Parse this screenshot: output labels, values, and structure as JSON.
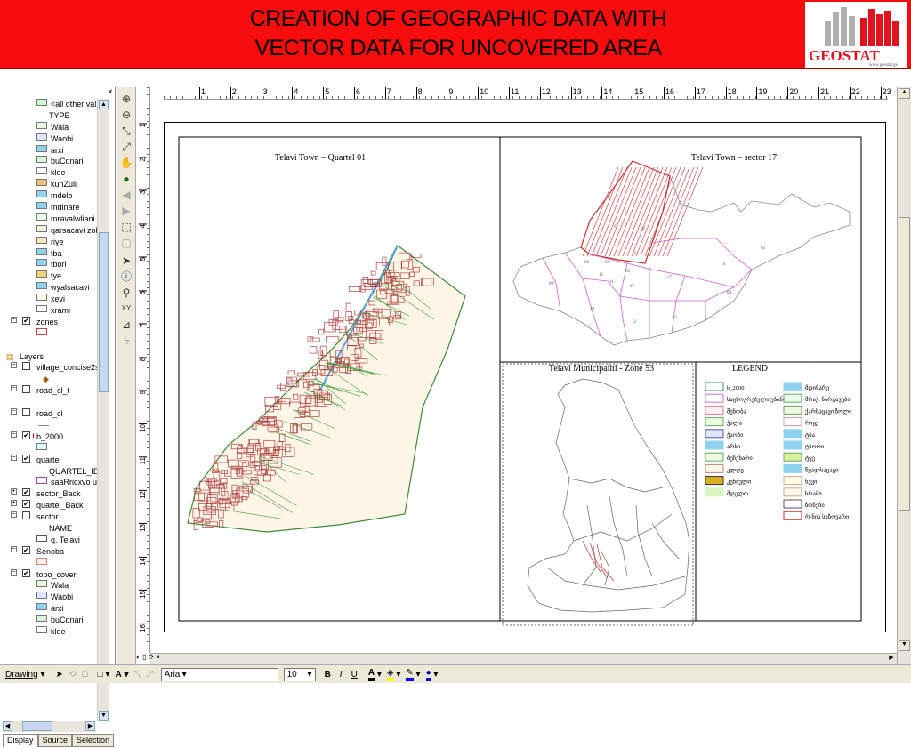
{
  "banner": {
    "title_line1": "CREATION OF GEOGRAPHIC DATA WITH",
    "title_line2": "VECTOR DATA FOR UNCOVERED AREA",
    "logo_text": "GEOSTAT",
    "logo_sub": "www.geostat.ge",
    "bg_color": "#f70d0d"
  },
  "toc": {
    "close": "×",
    "rows": [
      {
        "type": "item",
        "indent": 38,
        "swatch": "#ccffcc",
        "label": "<all other val"
      },
      {
        "type": "text",
        "indent": 52,
        "label": "TYPE"
      },
      {
        "type": "item",
        "indent": 38,
        "swatch": "#e8ffe0",
        "label": "Wala"
      },
      {
        "type": "item",
        "indent": 38,
        "swatch": "#dfe6ff",
        "label": "Waobi"
      },
      {
        "type": "item",
        "indent": 38,
        "swatch": "#8fd3f0",
        "label": "arxi"
      },
      {
        "type": "item",
        "indent": 38,
        "swatch": "#d9f5d9",
        "label": "buCqnari"
      },
      {
        "type": "item",
        "indent": 38,
        "swatch": "#ffffff",
        "label": "klde"
      },
      {
        "type": "item",
        "indent": 38,
        "swatch": "#f2c27a",
        "label": "kunZuli"
      },
      {
        "type": "item",
        "indent": 38,
        "swatch": "#8fd3f0",
        "label": "mdelo"
      },
      {
        "type": "item",
        "indent": 38,
        "swatch": "#8fd3f0",
        "label": "mdinare"
      },
      {
        "type": "item",
        "indent": 38,
        "swatch": "#eaffea",
        "label": "mravalwliani r"
      },
      {
        "type": "item",
        "indent": 38,
        "swatch": "#eefae0",
        "label": "qarsacavi zoli"
      },
      {
        "type": "item",
        "indent": 38,
        "swatch": "#ffe6c0",
        "label": "riye"
      },
      {
        "type": "item",
        "indent": 38,
        "swatch": "#8fd3f0",
        "label": "tba"
      },
      {
        "type": "item",
        "indent": 38,
        "swatch": "#8fd3f0",
        "label": "tbori"
      },
      {
        "type": "item",
        "indent": 38,
        "swatch": "#f2d27a",
        "label": "tye"
      },
      {
        "type": "item",
        "indent": 38,
        "swatch": "#8fd3f0",
        "label": "wyalsacavi"
      },
      {
        "type": "item",
        "indent": 38,
        "swatch": "#fffbe8",
        "label": "xevi"
      },
      {
        "type": "item",
        "indent": 38,
        "swatch": "#ffffff",
        "label": "xrami"
      },
      {
        "type": "layer",
        "pm": "−",
        "checked": true,
        "label": "zones"
      },
      {
        "type": "item",
        "indent": 38,
        "swatch": "#ffffff",
        "border": "#d04040",
        "label": ""
      },
      {
        "type": "blank"
      },
      {
        "type": "group",
        "label": "Layers"
      },
      {
        "type": "layer",
        "pm": "−",
        "checked": false,
        "label": "village_concise2s"
      },
      {
        "type": "dot",
        "indent": 45,
        "label": ""
      },
      {
        "type": "layer",
        "pm": "−",
        "checked": false,
        "label": "road_cl_t"
      },
      {
        "type": "blank"
      },
      {
        "type": "layer",
        "pm": "−",
        "checked": false,
        "label": "road_cl"
      },
      {
        "type": "line",
        "indent": 40,
        "label": ""
      },
      {
        "type": "layer",
        "pm": "−",
        "checked": true,
        "label": "b_2000",
        "bang": "!"
      },
      {
        "type": "item",
        "indent": 38,
        "swatch": "#e0fff8",
        "label": ""
      },
      {
        "type": "layer",
        "pm": "−",
        "checked": true,
        "label": "quartel"
      },
      {
        "type": "text",
        "indent": 52,
        "label": "QUARTEL_ID"
      },
      {
        "type": "item",
        "indent": 38,
        "swatch": "#ffffff",
        "border": "#b040b0",
        "label": "saaRricxvo ub"
      },
      {
        "type": "layer",
        "pm": "+",
        "checked": true,
        "label": "sector_Back"
      },
      {
        "type": "layer",
        "pm": "+",
        "checked": true,
        "label": "quartel_Back"
      },
      {
        "type": "layer",
        "pm": "−",
        "checked": false,
        "label": "sector"
      },
      {
        "type": "text",
        "indent": 52,
        "label": "NAME"
      },
      {
        "type": "item",
        "indent": 38,
        "swatch": "#ffffff",
        "border": "#555",
        "label": "q. Telavi"
      },
      {
        "type": "layer",
        "pm": "−",
        "checked": true,
        "label": "Senoba"
      },
      {
        "type": "item",
        "indent": 38,
        "swatch": "#fff0f0",
        "border": "#e08080",
        "label": ""
      },
      {
        "type": "layer",
        "pm": "−",
        "checked": true,
        "label": "topo_cover"
      },
      {
        "type": "item",
        "indent": 38,
        "swatch": "#e8ffe0",
        "label": "Wala"
      },
      {
        "type": "item",
        "indent": 38,
        "swatch": "#dfe6ff",
        "label": "Waobi"
      },
      {
        "type": "item",
        "indent": 38,
        "swatch": "#8fd3f0",
        "label": "arxi"
      },
      {
        "type": "item",
        "indent": 38,
        "swatch": "#d9f5d9",
        "label": "buCqnari"
      },
      {
        "type": "item",
        "indent": 38,
        "swatch": "#ffffff",
        "label": "klde"
      }
    ],
    "tabs": [
      "Display",
      "Source",
      "Selection"
    ]
  },
  "ruler": {
    "labels": [
      "1",
      "2",
      "3",
      "4",
      "5",
      "6",
      "7",
      "8",
      "9",
      "10",
      "11",
      "12",
      "13",
      "14",
      "15",
      "16",
      "17",
      "18",
      "19",
      "20",
      "21",
      "22",
      "23"
    ],
    "vlabels": [
      "1",
      "2",
      "3",
      "4",
      "5",
      "6",
      "7",
      "8",
      "9",
      "10",
      "11",
      "12",
      "13",
      "14",
      "15",
      "16"
    ]
  },
  "maps": {
    "quartel_title": "Telavi Town – Quartel 01",
    "sector_title": "Telavi Town – sector 17",
    "zone_title": "Telavi  Municipaliti - Zone 53",
    "legend_title": "LEGEND",
    "sector_labels": [
      "01",
      "02",
      "03",
      "04",
      "05",
      "06",
      "07",
      "08",
      "09",
      "10",
      "11",
      "12",
      "13",
      "14",
      "15",
      "16",
      "17"
    ],
    "legend_left": [
      {
        "label": "b_2000",
        "fill": "#ffffff",
        "stroke": "#3a8a8a"
      },
      {
        "label": "საცხოვრებელი უბანი",
        "fill": "#ffffff",
        "stroke": "#d070d0"
      },
      {
        "label": "შენობა",
        "fill": "#fff0f4",
        "stroke": "#e08090"
      },
      {
        "label": "ჭალა",
        "fill": "#e8ffe0",
        "stroke": "#6a6"
      },
      {
        "label": "ჭაობი",
        "fill": "#dfe6ff",
        "stroke": "#55a"
      },
      {
        "label": "არხი",
        "fill": "#8fd3f0",
        "stroke": "#8fd3f0"
      },
      {
        "label": "ბუჩქნარი",
        "fill": "#eefae0",
        "stroke": "#6a6"
      },
      {
        "label": "კლდე",
        "fill": "#fff8e8",
        "stroke": "#b88"
      },
      {
        "label": "კუნძული",
        "fill": "#d8b020",
        "stroke": "#333"
      },
      {
        "label": "მდელო",
        "fill": "#d9f5c0",
        "stroke": "#d9f5c0"
      }
    ],
    "legend_right": [
      {
        "label": "მდინარე",
        "fill": "#8fd3f0",
        "stroke": "#8fd3f0"
      },
      {
        "label": "მრავ. ნარგავები",
        "fill": "#eaffea",
        "stroke": "#6a6"
      },
      {
        "label": "ქარსაცავი ზოლი",
        "fill": "#eefae0",
        "stroke": "#6a6"
      },
      {
        "label": "რიყე",
        "fill": "#ffffff",
        "stroke": "#c9a"
      },
      {
        "label": "ტბა",
        "fill": "#8fd3f0",
        "stroke": "#8fd3f0"
      },
      {
        "label": "ტბორი",
        "fill": "#8fd3f0",
        "stroke": "#8fd3f0"
      },
      {
        "label": "ტყე",
        "fill": "#d8f0a0",
        "stroke": "#6a6"
      },
      {
        "label": "წყალსაცავი",
        "fill": "#8fd3f0",
        "stroke": "#8fd3f0"
      },
      {
        "label": "ხევი",
        "fill": "#fffbe8",
        "stroke": "#ca8"
      },
      {
        "label": "ხრამი",
        "fill": "#fff8ec",
        "stroke": "#ca8"
      },
      {
        "label": "ზონები",
        "fill": "#ffffff",
        "stroke": "#555"
      },
      {
        "label": "რ-ნის საზღვარი",
        "fill": "#ffffff",
        "stroke": "#d02020"
      }
    ]
  },
  "drawbar": {
    "drawing": "Drawing",
    "font": "Arial",
    "size": "10",
    "bold": "B",
    "italic": "I",
    "underline": "U",
    "text_tool": "A"
  }
}
